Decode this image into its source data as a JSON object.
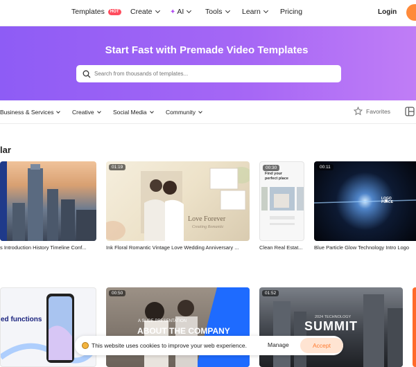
{
  "nav": {
    "templates": "Templates",
    "hot": "HOT",
    "create": "Create",
    "ai": "AI",
    "tools": "Tools",
    "learn": "Learn",
    "pricing": "Pricing",
    "login": "Login"
  },
  "hero": {
    "title": "Start Fast with Premade Video Templates",
    "search_placeholder": "Search from thousands of templates..."
  },
  "categories": {
    "business": "Business & Services",
    "creative": "Creative",
    "social": "Social Media",
    "community": "Community",
    "favorites": "Favorites"
  },
  "section": {
    "title": "lar"
  },
  "cards": {
    "c1": {
      "caption": "s Introduction History Timeline Conf..."
    },
    "c2": {
      "time": "01:19",
      "caption": "Ink Floral Romantic Vintage Love Wedding Anniversary ...",
      "overlay_title": "Love Forever",
      "overlay_sub": "Creating Romantic"
    },
    "c3": {
      "time": "00:30",
      "caption": "Clean Real Estat...",
      "overlay_title": "Find your perfect place"
    },
    "c4": {
      "time": "00:11",
      "caption": "Blue Particle Glow Technology Intro Logo",
      "logo": "LOGO PLACE"
    },
    "c5": {
      "text": "ed functions"
    },
    "c6": {
      "time": "00:50",
      "kicker": "A SLIDE PRESENTATION",
      "title": "ABOUT THE COMPANY"
    },
    "c7": {
      "time": "01:52",
      "kicker": "2024 TECHNOLOGY",
      "title": "SUMMIT"
    }
  },
  "cookie": {
    "text": "This website uses cookies to improve your web experience.",
    "manage": "Manage",
    "accept": "Accept"
  },
  "colors": {
    "accent_orange": "#ff8a3a",
    "hero_start": "#8e5cf5",
    "hero_end": "#c07df6",
    "hot_badge": "#ff4d5e"
  }
}
